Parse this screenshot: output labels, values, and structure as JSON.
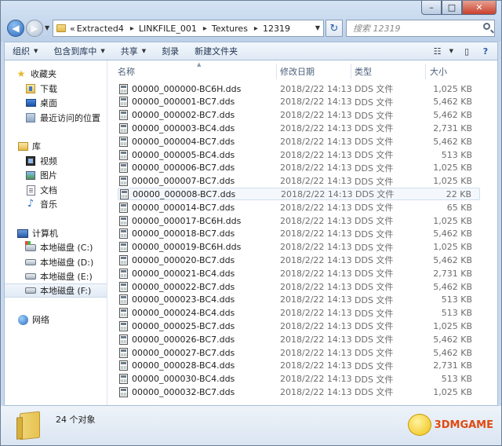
{
  "window": {
    "caption_buttons": {
      "minimize": "–",
      "maximize": "□",
      "close": "✕"
    }
  },
  "address": {
    "prefix": "«",
    "breadcrumbs": [
      "Extracted4",
      "LINKFILE_001",
      "Textures",
      "12319"
    ]
  },
  "search": {
    "placeholder": "搜索 12319"
  },
  "toolbar": {
    "organize": "组织",
    "include_in_library": "包含到库中",
    "share": "共享",
    "burn": "刻录",
    "new_folder": "新建文件夹"
  },
  "sidebar": {
    "favorites": {
      "label": "收藏夹",
      "items": [
        "下载",
        "桌面",
        "最近访问的位置"
      ]
    },
    "libraries": {
      "label": "库",
      "items": [
        "视频",
        "图片",
        "文档",
        "音乐"
      ]
    },
    "computer": {
      "label": "计算机",
      "items": [
        "本地磁盘 (C:)",
        "本地磁盘 (D:)",
        "本地磁盘 (E:)",
        "本地磁盘 (F:)"
      ]
    },
    "network": {
      "label": "网络"
    }
  },
  "columns": {
    "name": "名称",
    "modified": "修改日期",
    "type": "类型",
    "size": "大小"
  },
  "files": [
    {
      "name": "00000_000000-BC6H.dds",
      "date": "2018/2/22 14:13",
      "type": "DDS 文件",
      "size": "1,025 KB"
    },
    {
      "name": "00000_000001-BC7.dds",
      "date": "2018/2/22 14:13",
      "type": "DDS 文件",
      "size": "5,462 KB"
    },
    {
      "name": "00000_000002-BC7.dds",
      "date": "2018/2/22 14:13",
      "type": "DDS 文件",
      "size": "5,462 KB"
    },
    {
      "name": "00000_000003-BC4.dds",
      "date": "2018/2/22 14:13",
      "type": "DDS 文件",
      "size": "2,731 KB"
    },
    {
      "name": "00000_000004-BC7.dds",
      "date": "2018/2/22 14:13",
      "type": "DDS 文件",
      "size": "5,462 KB"
    },
    {
      "name": "00000_000005-BC4.dds",
      "date": "2018/2/22 14:13",
      "type": "DDS 文件",
      "size": "513 KB"
    },
    {
      "name": "00000_000006-BC7.dds",
      "date": "2018/2/22 14:13",
      "type": "DDS 文件",
      "size": "1,025 KB"
    },
    {
      "name": "00000_000007-BC7.dds",
      "date": "2018/2/22 14:13",
      "type": "DDS 文件",
      "size": "1,025 KB"
    },
    {
      "name": "00000_000008-BC7.dds",
      "date": "2018/2/22 14:13",
      "type": "DDS 文件",
      "size": "22 KB"
    },
    {
      "name": "00000_000014-BC7.dds",
      "date": "2018/2/22 14:13",
      "type": "DDS 文件",
      "size": "65 KB"
    },
    {
      "name": "00000_000017-BC6H.dds",
      "date": "2018/2/22 14:13",
      "type": "DDS 文件",
      "size": "1,025 KB"
    },
    {
      "name": "00000_000018-BC7.dds",
      "date": "2018/2/22 14:13",
      "type": "DDS 文件",
      "size": "5,462 KB"
    },
    {
      "name": "00000_000019-BC6H.dds",
      "date": "2018/2/22 14:13",
      "type": "DDS 文件",
      "size": "1,025 KB"
    },
    {
      "name": "00000_000020-BC7.dds",
      "date": "2018/2/22 14:13",
      "type": "DDS 文件",
      "size": "5,462 KB"
    },
    {
      "name": "00000_000021-BC4.dds",
      "date": "2018/2/22 14:13",
      "type": "DDS 文件",
      "size": "2,731 KB"
    },
    {
      "name": "00000_000022-BC7.dds",
      "date": "2018/2/22 14:13",
      "type": "DDS 文件",
      "size": "5,462 KB"
    },
    {
      "name": "00000_000023-BC4.dds",
      "date": "2018/2/22 14:13",
      "type": "DDS 文件",
      "size": "513 KB"
    },
    {
      "name": "00000_000024-BC4.dds",
      "date": "2018/2/22 14:13",
      "type": "DDS 文件",
      "size": "513 KB"
    },
    {
      "name": "00000_000025-BC7.dds",
      "date": "2018/2/22 14:13",
      "type": "DDS 文件",
      "size": "1,025 KB"
    },
    {
      "name": "00000_000026-BC7.dds",
      "date": "2018/2/22 14:13",
      "type": "DDS 文件",
      "size": "5,462 KB"
    },
    {
      "name": "00000_000027-BC7.dds",
      "date": "2018/2/22 14:13",
      "type": "DDS 文件",
      "size": "5,462 KB"
    },
    {
      "name": "00000_000028-BC4.dds",
      "date": "2018/2/22 14:13",
      "type": "DDS 文件",
      "size": "2,731 KB"
    },
    {
      "name": "00000_000030-BC4.dds",
      "date": "2018/2/22 14:13",
      "type": "DDS 文件",
      "size": "513 KB"
    },
    {
      "name": "00000_000032-BC7.dds",
      "date": "2018/2/22 14:13",
      "type": "DDS 文件",
      "size": "1,025 KB"
    }
  ],
  "status": {
    "count_text": "24 个对象"
  },
  "watermark": {
    "text": "3DMGAME"
  }
}
